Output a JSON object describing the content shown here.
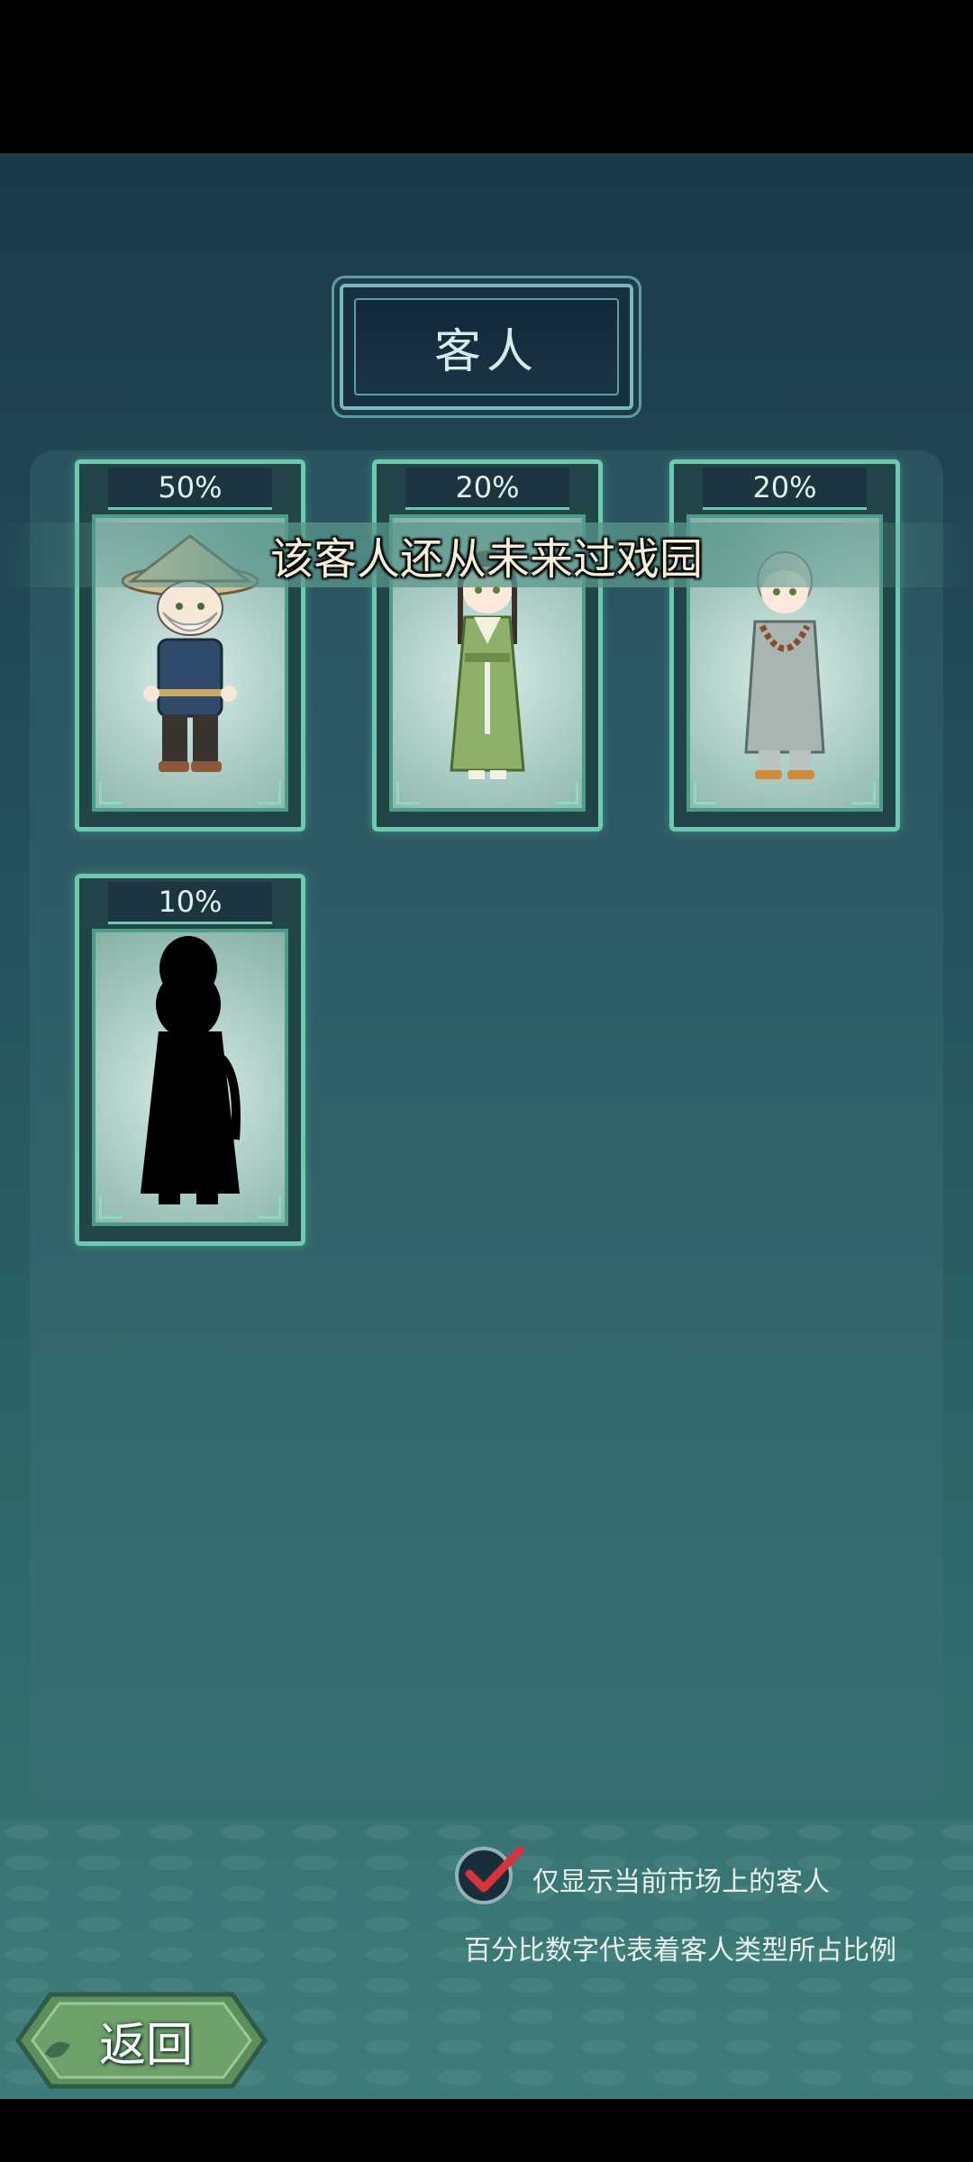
{
  "header": {
    "title": "客人"
  },
  "guests": [
    {
      "percent": "50%",
      "figure": "fisherman-straw-hat",
      "locked": false
    },
    {
      "percent": "20%",
      "figure": "girl-green-hanfu",
      "locked": false
    },
    {
      "percent": "20%",
      "figure": "monk-grey-robe",
      "locked": false
    },
    {
      "percent": "10%",
      "figure": "silhouette",
      "locked": true
    }
  ],
  "toast": {
    "message": "该客人还从未来过戏园"
  },
  "filter": {
    "label": "仅显示当前市场上的客人",
    "checked": true,
    "check_color": "#d8323a"
  },
  "hint": {
    "text": "百分比数字代表着客人类型所占比例"
  },
  "footer": {
    "back_label": "返回"
  },
  "colors": {
    "card_border": "#6fc9b0",
    "background_top": "#1c3a48",
    "background_bottom": "#3a7574"
  }
}
